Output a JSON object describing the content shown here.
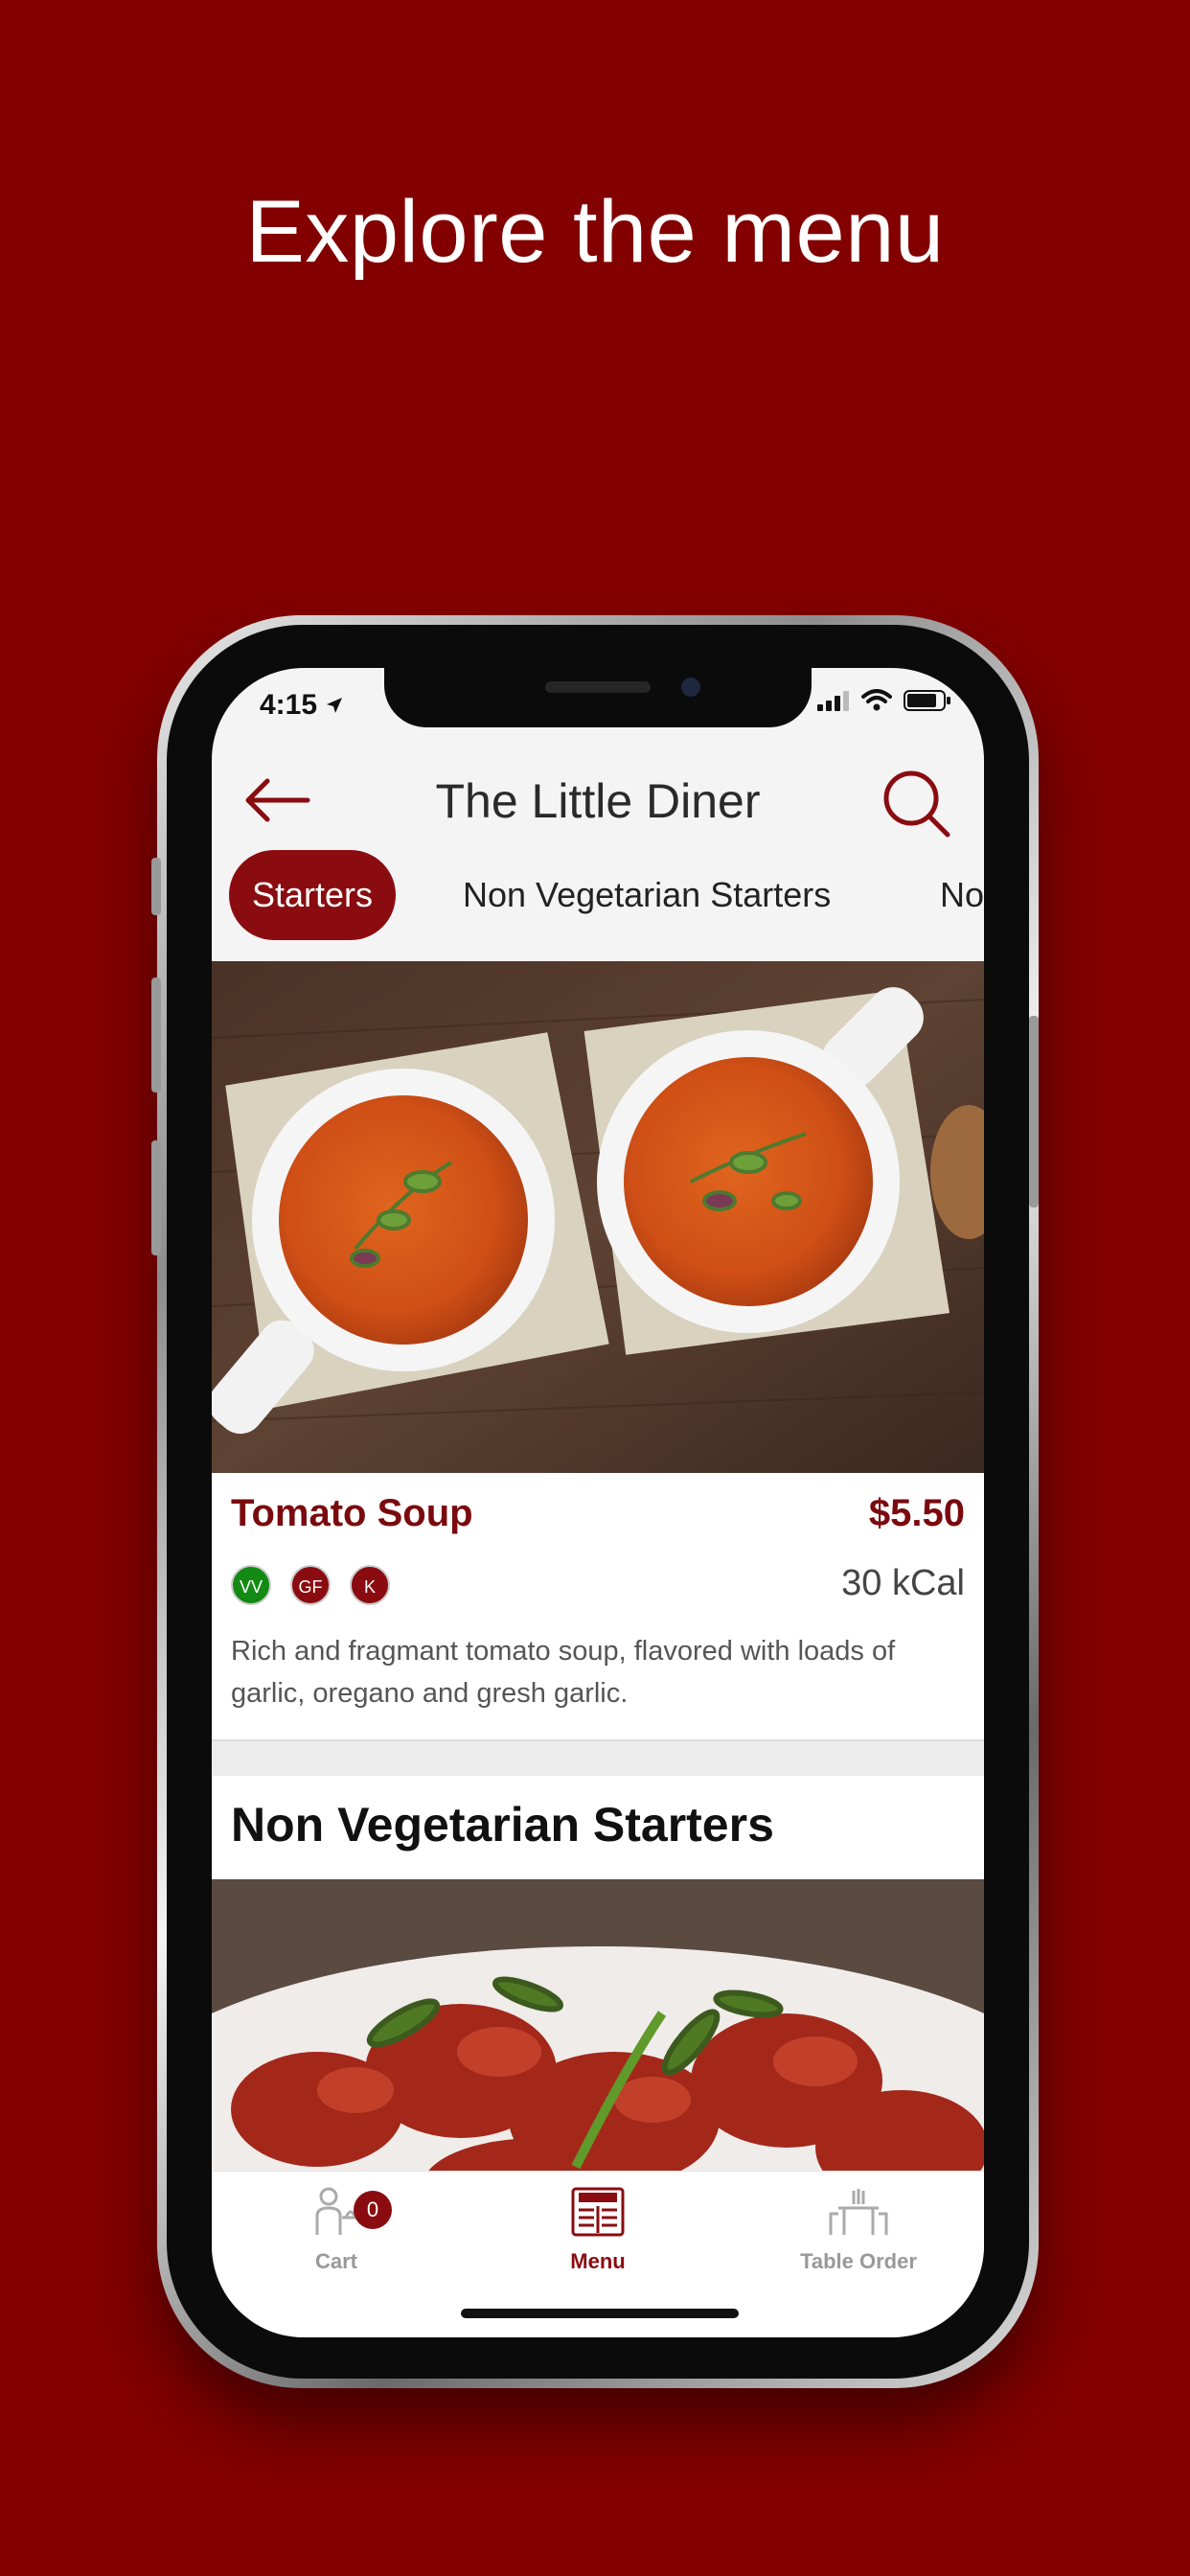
{
  "promo": {
    "headline": "Explore the menu"
  },
  "status_bar": {
    "time": "4:15"
  },
  "header": {
    "title": "The Little Diner",
    "back_icon": "arrow-left-icon",
    "search_icon": "search-icon"
  },
  "categories": [
    {
      "label": "Starters",
      "active": true
    },
    {
      "label": "Non Vegetarian Starters",
      "active": false
    },
    {
      "label": "No",
      "active": false
    }
  ],
  "dishes": [
    {
      "name": "Tomato Soup",
      "price": "$5.50",
      "calories": "30 kCal",
      "badges": [
        {
          "label": "VV",
          "color": "#138a13"
        },
        {
          "label": "GF",
          "color": "#8a0c10"
        },
        {
          "label": "K",
          "color": "#8a0c10"
        }
      ],
      "description": "Rich and fragmant tomato soup, flavored with loads of garlic, oregano and gresh garlic."
    }
  ],
  "sections": [
    {
      "title": "Non Vegetarian Starters"
    }
  ],
  "tabbar": {
    "items": [
      {
        "label": "Cart",
        "icon": "cart-waiter-icon",
        "badge": "0",
        "active": false
      },
      {
        "label": "Menu",
        "icon": "menu-book-icon",
        "active": true
      },
      {
        "label": "Table Order",
        "icon": "dining-table-icon",
        "active": false
      }
    ]
  },
  "colors": {
    "brand": "#8a0c10",
    "background": "#820000",
    "veg": "#138a13"
  }
}
